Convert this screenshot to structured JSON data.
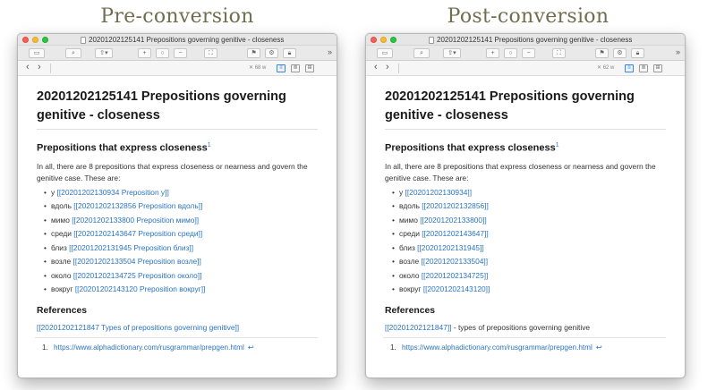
{
  "headings": {
    "left": "Pre-conversion",
    "right": "Post-conversion"
  },
  "windows": [
    {
      "title": "20201202125141 Prepositions governing genitive - closeness",
      "word_count": "68 w",
      "doc_title": "20201202125141 Prepositions governing genitive - closeness",
      "section_heading": "Prepositions that express closeness",
      "footnote_marker": "1",
      "intro": "In all, there are 8 prepositions that express closeness or nearness and govern the genitive case. These are:",
      "items": [
        {
          "word": "у",
          "link": "[[20201202130934 Preposition у]]"
        },
        {
          "word": "вдоль",
          "link": "[[20201202132856 Preposition вдоль]]"
        },
        {
          "word": "мимо",
          "link": "[[20201202133800 Preposition мимо]]"
        },
        {
          "word": "среди",
          "link": "[[20201202143647 Preposition среди]]"
        },
        {
          "word": "близ",
          "link": "[[20201202131945 Preposition близ]]"
        },
        {
          "word": "возле",
          "link": "[[20201202133504 Preposition возле]]"
        },
        {
          "word": "около",
          "link": "[[20201202134725 Preposition около]]"
        },
        {
          "word": "вокруг",
          "link": "[[20201202143120 Preposition вокруг]]"
        }
      ],
      "references_heading": "References",
      "reference_link": "[[20201202121847 Types of prepositions governing genitive]]",
      "reference_suffix": "",
      "footnote_number": "1.",
      "footnote_url": "https://www.alphadictionary.com/rusgrammar/prepgen.html",
      "footnote_back": "↩"
    },
    {
      "title": "20201202125141 Prepositions governing genitive - closeness",
      "word_count": "62 w",
      "doc_title": "20201202125141 Prepositions governing genitive - closeness",
      "section_heading": "Prepositions that express closeness",
      "footnote_marker": "1",
      "intro": "In all, there are 8 prepositions that express closeness or nearness and govern the genitive case. These are:",
      "items": [
        {
          "word": "у",
          "link": "[[20201202130934]]"
        },
        {
          "word": "вдоль",
          "link": "[[20201202132856]]"
        },
        {
          "word": "мимо",
          "link": "[[20201202133800]]"
        },
        {
          "word": "среди",
          "link": "[[20201202143647]]"
        },
        {
          "word": "близ",
          "link": "[[20201202131945]]"
        },
        {
          "word": "возле",
          "link": "[[20201202133504]]"
        },
        {
          "word": "около",
          "link": "[[20201202134725]]"
        },
        {
          "word": "вокруг",
          "link": "[[20201202143120]]"
        }
      ],
      "references_heading": "References",
      "reference_link": "[[20201202121847]]",
      "reference_suffix": " - types of prepositions governing genitive",
      "footnote_number": "1.",
      "footnote_url": "https://www.alphadictionary.com/rusgrammar/prepgen.html",
      "footnote_back": "↩"
    }
  ],
  "toolbar_icons": [
    "sidebar-icon",
    "search-icon",
    "share-icon",
    "zoom-in-icon",
    "zoom-reset-icon",
    "zoom-out-icon",
    "fullscreen-icon",
    "flag-icon",
    "settings-icon",
    "lock-icon",
    "more-icon"
  ],
  "accent_color": "#2a74c2"
}
